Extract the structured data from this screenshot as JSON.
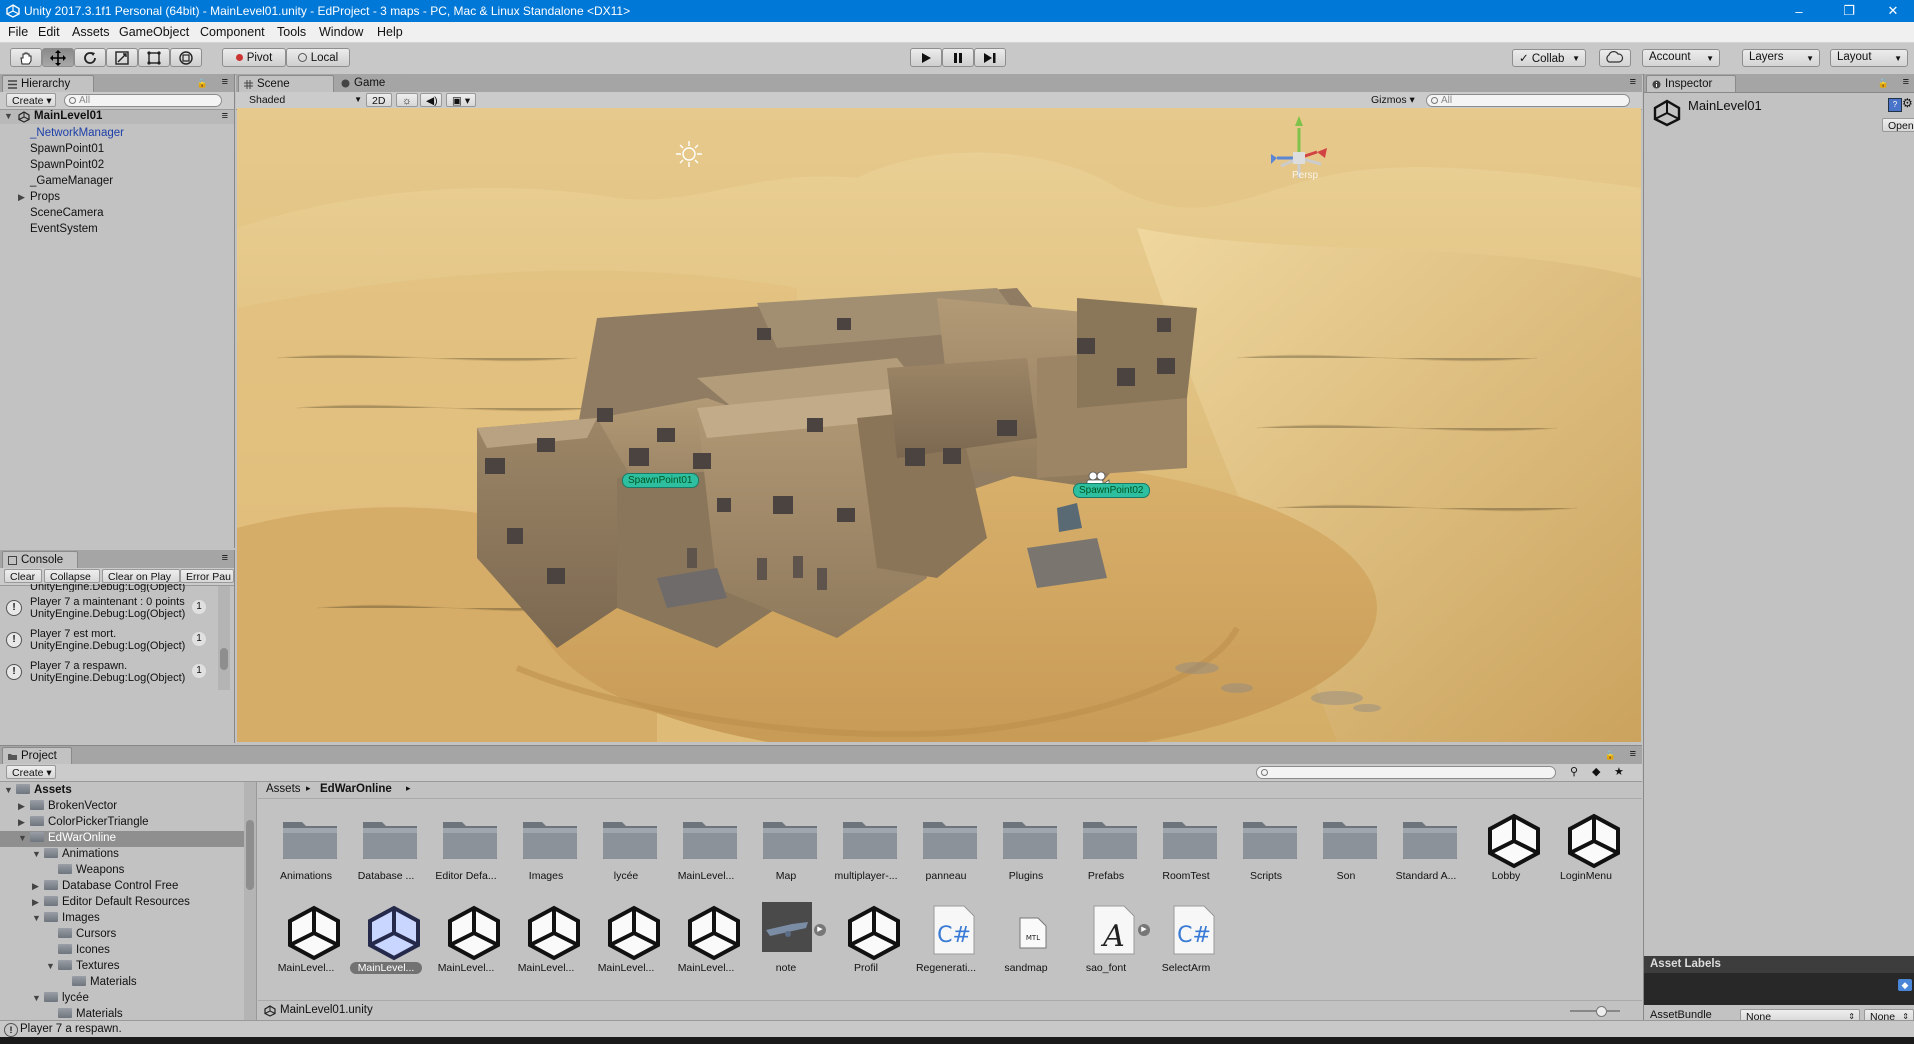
{
  "window": {
    "title": "Unity 2017.3.1f1 Personal (64bit) - MainLevel01.unity - EdProject - 3 maps - PC, Mac & Linux Standalone <DX11>",
    "minimize": "–",
    "maximize": "❐",
    "close": "✕"
  },
  "menu": [
    "File",
    "Edit",
    "Assets",
    "GameObject",
    "Component",
    "Tools",
    "Window",
    "Help"
  ],
  "toolbar": {
    "pivot": "Pivot",
    "local": "Local",
    "collab": "Collab",
    "account": "Account",
    "layers": "Layers",
    "layout": "Layout"
  },
  "hierarchy": {
    "tab": "Hierarchy",
    "create": "Create",
    "search_placeholder": "All",
    "root": "MainLevel01",
    "items": [
      "_NetworkManager",
      "SpawnPoint01",
      "SpawnPoint02",
      "_GameManager",
      "Props",
      "SceneCamera",
      "EventSystem"
    ]
  },
  "scene": {
    "tab_scene": "Scene",
    "tab_game": "Game",
    "shading": "Shaded",
    "mode_2d": "2D",
    "gizmos": "Gizmos",
    "search_placeholder": "All",
    "persp": "Persp",
    "spawn1": "SpawnPoint01",
    "spawn2": "SpawnPoint02"
  },
  "console": {
    "tab": "Console",
    "buttons": [
      "Clear",
      "Collapse",
      "Clear on Play",
      "Error Pau"
    ],
    "partial": "UnityEngine.Debug:Log(Object)",
    "rows": [
      {
        "l1": "Player 7 a maintenant : 0 points",
        "l2": "UnityEngine.Debug:Log(Object)",
        "count": "1"
      },
      {
        "l1": "Player 7 est mort.",
        "l2": "UnityEngine.Debug:Log(Object)",
        "count": "1"
      },
      {
        "l1": "Player 7 a respawn.",
        "l2": "UnityEngine.Debug:Log(Object)",
        "count": "1"
      }
    ]
  },
  "project": {
    "tab": "Project",
    "create": "Create",
    "tree": [
      "Assets",
      "BrokenVector",
      "ColorPickerTriangle",
      "EdWarOnline",
      "Animations",
      "Weapons",
      "Database Control Free",
      "Editor Default Resources",
      "Images",
      "Cursors",
      "Icones",
      "Textures",
      "Materials",
      "lycée",
      "Materials"
    ],
    "breadcrumb_root": "Assets",
    "breadcrumb_current": "EdWarOnline",
    "row1": [
      "Animations",
      "Database ...",
      "Editor Defa...",
      "Images",
      "lycée",
      "MainLevel...",
      "Map",
      "multiplayer-...",
      "panneau",
      "Plugins",
      "Prefabs",
      "RoomTest",
      "Scripts",
      "Son",
      "Standard A...",
      "Lobby",
      "LoginMenu"
    ],
    "row2": [
      "MainLevel...",
      "MainLevel...",
      "MainLevel...",
      "MainLevel...",
      "MainLevel...",
      "MainLevel...",
      "note",
      "Profil",
      "Regenerati...",
      "sandmap",
      "sao_font",
      "SelectArm"
    ],
    "selected_file": "MainLevel01.unity"
  },
  "inspector": {
    "tab": "Inspector",
    "object": "MainLevel01",
    "open": "Open",
    "asset_labels": "Asset Labels",
    "asset_bundle": "AssetBundle",
    "bundle_value": "None",
    "bundle_variant": "None"
  },
  "status": "Player 7 a respawn."
}
